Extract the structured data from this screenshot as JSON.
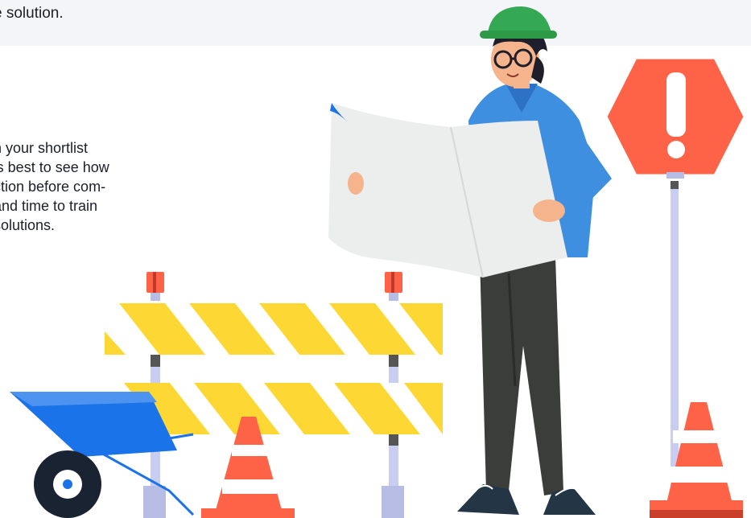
{
  "banner": {
    "text": "e solution."
  },
  "paragraph": {
    "lines": [
      "n your shortlist",
      "’s best to see how",
      "ction before com-",
      " and time to train",
      "solutions."
    ]
  },
  "colors": {
    "banner_bg": "#f3f5f8",
    "stop_sign": "#ff6347",
    "helmet": "#34a853",
    "shirt": "#3e8fe0",
    "barricade_yellow": "#fdd835",
    "cone": "#ff6347",
    "wheelbarrow": "#1a73e8"
  },
  "illustration": {
    "description_icon": "construction-worker-icon"
  }
}
